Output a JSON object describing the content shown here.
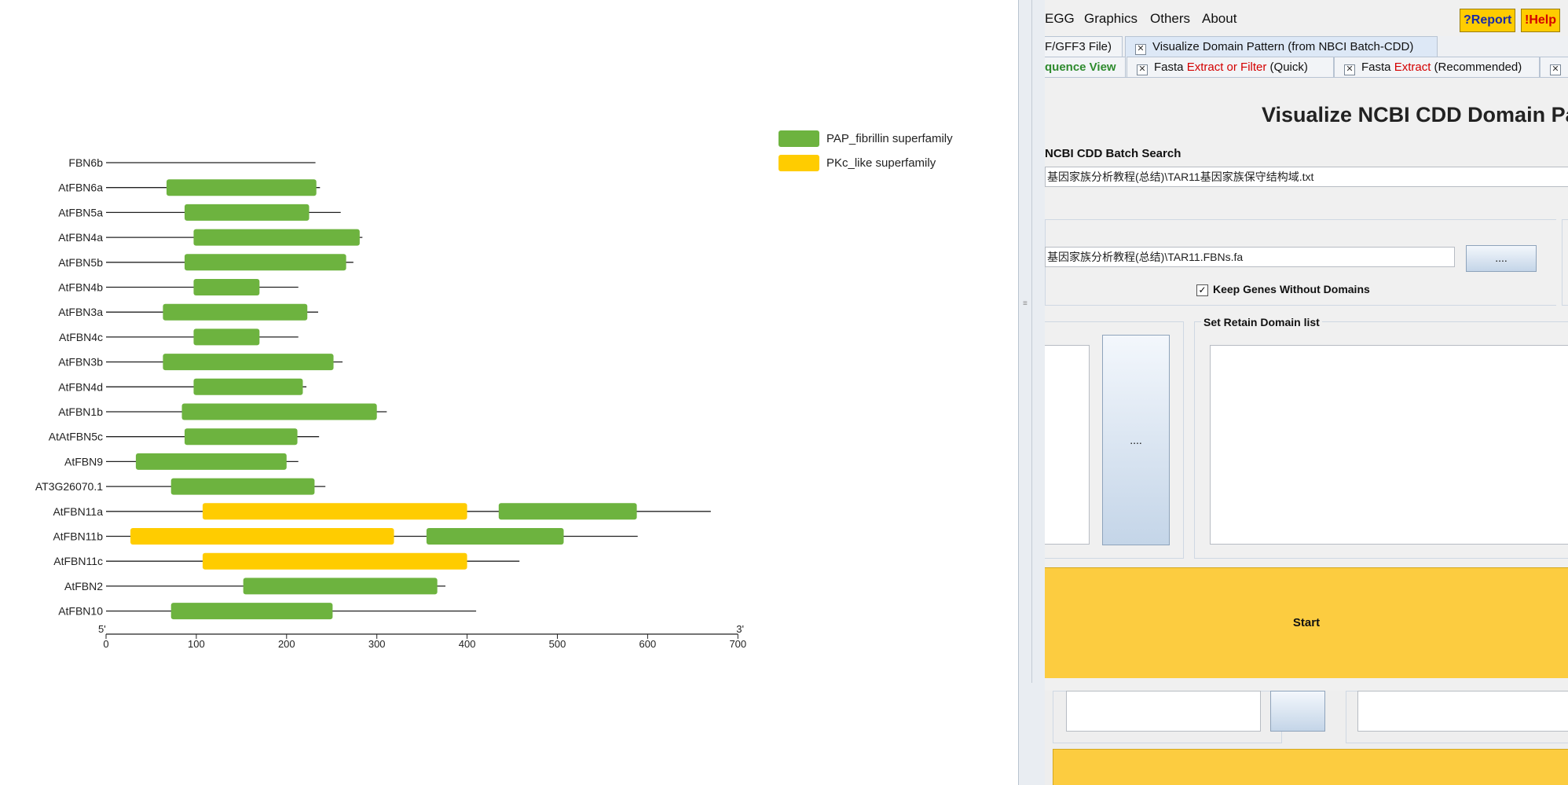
{
  "chart_data": {
    "type": "gene-structure",
    "xlim": [
      0,
      700
    ],
    "ticks": [
      0,
      100,
      200,
      300,
      400,
      500,
      600,
      700
    ],
    "end_labels": {
      "left": "5'",
      "right": "3'"
    },
    "legend": [
      {
        "name": "PAP_fibrillin superfamily",
        "color": "#6db33f"
      },
      {
        "name": "PKc_like superfamily",
        "color": "#ffcc00"
      }
    ],
    "genes": [
      {
        "name": "FBN6b",
        "length": 232,
        "domains": []
      },
      {
        "name": "AtFBN6a",
        "length": 237,
        "domains": [
          {
            "type": 0,
            "start": 67,
            "end": 233
          }
        ]
      },
      {
        "name": "AtFBN5a",
        "length": 260,
        "domains": [
          {
            "type": 0,
            "start": 87,
            "end": 225
          }
        ]
      },
      {
        "name": "AtFBN4a",
        "length": 284,
        "domains": [
          {
            "type": 0,
            "start": 97,
            "end": 281
          }
        ]
      },
      {
        "name": "AtFBN5b",
        "length": 274,
        "domains": [
          {
            "type": 0,
            "start": 87,
            "end": 266
          }
        ]
      },
      {
        "name": "AtFBN4b",
        "length": 213,
        "domains": [
          {
            "type": 0,
            "start": 97,
            "end": 170
          }
        ]
      },
      {
        "name": "AtFBN3a",
        "length": 235,
        "domains": [
          {
            "type": 0,
            "start": 63,
            "end": 223
          }
        ]
      },
      {
        "name": "AtFBN4c",
        "length": 213,
        "domains": [
          {
            "type": 0,
            "start": 97,
            "end": 170
          }
        ]
      },
      {
        "name": "AtFBN3b",
        "length": 262,
        "domains": [
          {
            "type": 0,
            "start": 63,
            "end": 252
          }
        ]
      },
      {
        "name": "AtFBN4d",
        "length": 222,
        "domains": [
          {
            "type": 0,
            "start": 97,
            "end": 218
          }
        ]
      },
      {
        "name": "AtFBN1b",
        "length": 311,
        "domains": [
          {
            "type": 0,
            "start": 84,
            "end": 300
          }
        ]
      },
      {
        "name": "AtAtFBN5c",
        "length": 236,
        "domains": [
          {
            "type": 0,
            "start": 87,
            "end": 212
          }
        ]
      },
      {
        "name": "AtFBN9",
        "length": 213,
        "domains": [
          {
            "type": 0,
            "start": 33,
            "end": 200
          }
        ]
      },
      {
        "name": "AT3G26070.1",
        "length": 243,
        "domains": [
          {
            "type": 0,
            "start": 72,
            "end": 231
          }
        ]
      },
      {
        "name": "AtFBN11a",
        "length": 670,
        "domains": [
          {
            "type": 1,
            "start": 107,
            "end": 400
          },
          {
            "type": 0,
            "start": 435,
            "end": 588
          }
        ]
      },
      {
        "name": "AtFBN11b",
        "length": 589,
        "domains": [
          {
            "type": 1,
            "start": 27,
            "end": 319
          },
          {
            "type": 0,
            "start": 355,
            "end": 507
          }
        ]
      },
      {
        "name": "AtFBN11c",
        "length": 458,
        "domains": [
          {
            "type": 1,
            "start": 107,
            "end": 400
          }
        ]
      },
      {
        "name": "AtFBN2",
        "length": 376,
        "domains": [
          {
            "type": 0,
            "start": 152,
            "end": 367
          }
        ]
      },
      {
        "name": "AtFBN10",
        "length": 410,
        "domains": [
          {
            "type": 0,
            "start": 72,
            "end": 251
          }
        ]
      }
    ]
  },
  "menu": {
    "items": [
      "EGG",
      "Graphics",
      "Others",
      "About"
    ],
    "report_label": "?Report",
    "help_label": "!Help"
  },
  "tabs_row1": [
    {
      "label": "F/GFF3 File)",
      "active": false
    },
    {
      "label": "Visualize Domain Pattern (from NBCI Batch-CDD)",
      "active": true
    }
  ],
  "tabs_row2": {
    "sequence_view": "quence View",
    "fasta_quick": {
      "prefix": "Fasta ",
      "red": "Extract or Filter",
      "suffix": " (Quick)"
    },
    "fasta_recommended": {
      "prefix": "Fasta ",
      "red": "Extract",
      "suffix": " (Recommended)"
    }
  },
  "panel": {
    "title": "Visualize NCBI CDD Domain Pa",
    "batch_label": "NCBI CDD Batch Search",
    "batch_file": "基因家族分析教程(总结)\\TAR11基因家族保守结构域.txt",
    "fasta_file": "基因家族分析教程(总结)\\TAR11.FBNs.fa",
    "browse_label": "....",
    "keep_genes_label": "Keep Genes Without Domains",
    "keep_genes_checked": true,
    "retain_title": "Set Retain Domain list",
    "middle_button_label": "....",
    "start_label": "Start"
  }
}
